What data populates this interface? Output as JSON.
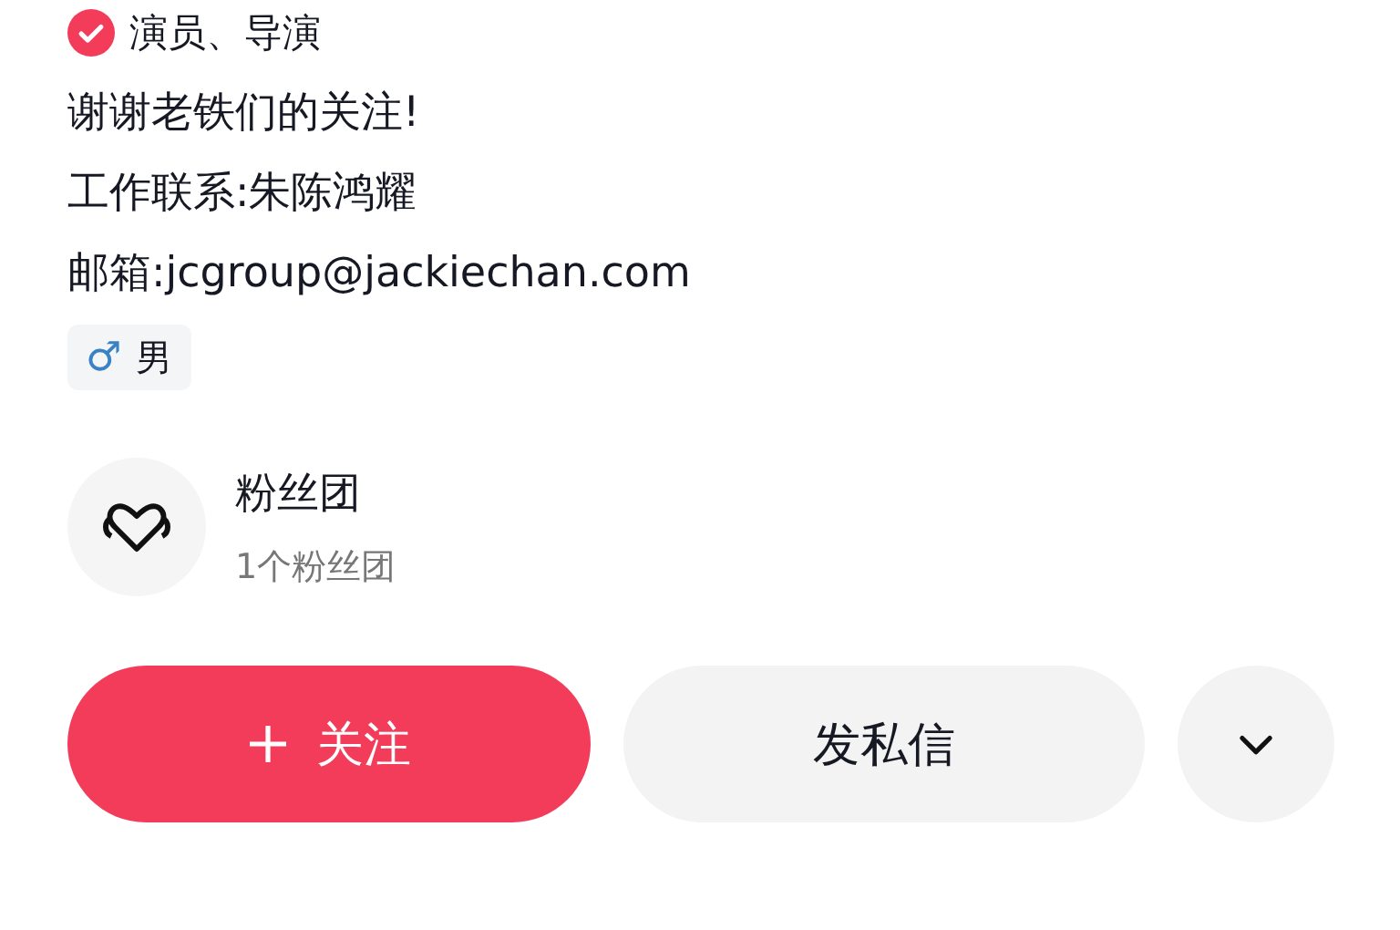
{
  "verified": {
    "label": "演员、导演"
  },
  "bio": [
    "谢谢老铁们的关注!",
    "工作联系:朱陈鸿耀",
    "邮箱:jcgroup@jackiechan.com"
  ],
  "gender": {
    "icon": "♂",
    "label": "男"
  },
  "fan_club": {
    "title": "粉丝团",
    "subtitle": "1个粉丝团"
  },
  "buttons": [
    {
      "kind": "follow",
      "label": "关注"
    },
    {
      "kind": "message",
      "label": "发私信"
    },
    {
      "kind": "more"
    }
  ]
}
